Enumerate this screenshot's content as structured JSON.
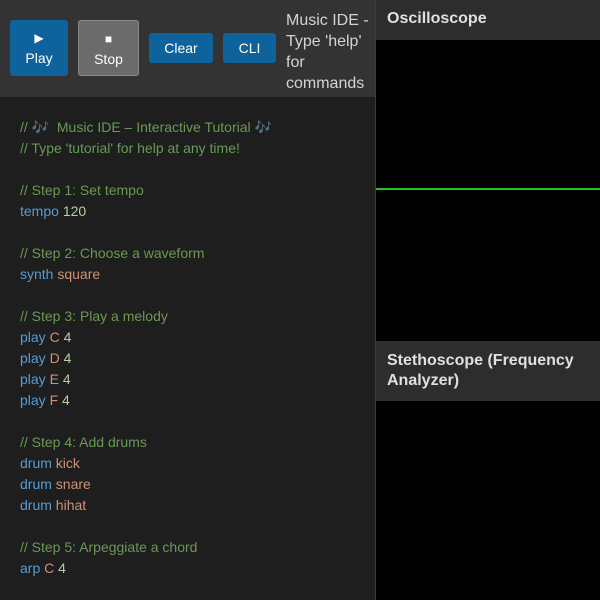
{
  "toolbar": {
    "play": {
      "label": "Play",
      "icon": "▶"
    },
    "stop": {
      "label": "Stop",
      "icon": "■"
    },
    "clear_label": "Clear",
    "cli_label": "CLI",
    "hint": "Music IDE - Type 'help' for commands"
  },
  "editor": {
    "lines": [
      [
        {
          "t": "// 🎶  Music IDE – Interactive Tutorial 🎶",
          "c": "c"
        }
      ],
      [
        {
          "t": "// Type 'tutorial' for help at any time!",
          "c": "c"
        }
      ],
      [],
      [
        {
          "t": "// Step 1: Set tempo",
          "c": "c"
        }
      ],
      [
        {
          "t": "tempo",
          "c": "k"
        },
        {
          "t": " "
        },
        {
          "t": "120",
          "c": "n"
        }
      ],
      [],
      [
        {
          "t": "// Step 2: Choose a waveform",
          "c": "c"
        }
      ],
      [
        {
          "t": "synth",
          "c": "k"
        },
        {
          "t": " "
        },
        {
          "t": "square",
          "c": "s"
        }
      ],
      [],
      [
        {
          "t": "// Step 3: Play a melody",
          "c": "c"
        }
      ],
      [
        {
          "t": "play",
          "c": "k"
        },
        {
          "t": " "
        },
        {
          "t": "C",
          "c": "s"
        },
        {
          "t": " "
        },
        {
          "t": "4",
          "c": "n"
        }
      ],
      [
        {
          "t": "play",
          "c": "k"
        },
        {
          "t": " "
        },
        {
          "t": "D",
          "c": "s"
        },
        {
          "t": " "
        },
        {
          "t": "4",
          "c": "n"
        }
      ],
      [
        {
          "t": "play",
          "c": "k"
        },
        {
          "t": " "
        },
        {
          "t": "E",
          "c": "s"
        },
        {
          "t": " "
        },
        {
          "t": "4",
          "c": "n"
        }
      ],
      [
        {
          "t": "play",
          "c": "k"
        },
        {
          "t": " "
        },
        {
          "t": "F",
          "c": "s"
        },
        {
          "t": " "
        },
        {
          "t": "4",
          "c": "n"
        }
      ],
      [],
      [
        {
          "t": "// Step 4: Add drums",
          "c": "c"
        }
      ],
      [
        {
          "t": "drum",
          "c": "k"
        },
        {
          "t": " "
        },
        {
          "t": "kick",
          "c": "s"
        }
      ],
      [
        {
          "t": "drum",
          "c": "k"
        },
        {
          "t": " "
        },
        {
          "t": "snare",
          "c": "s"
        }
      ],
      [
        {
          "t": "drum",
          "c": "k"
        },
        {
          "t": " "
        },
        {
          "t": "hihat",
          "c": "s"
        }
      ],
      [],
      [
        {
          "t": "// Step 5: Arpeggiate a chord",
          "c": "c"
        }
      ],
      [
        {
          "t": "arp",
          "c": "k"
        },
        {
          "t": " "
        },
        {
          "t": "C",
          "c": "s"
        },
        {
          "t": " "
        },
        {
          "t": "4",
          "c": "n"
        }
      ]
    ]
  },
  "panels": {
    "oscilloscope_title": "Oscilloscope",
    "stethoscope_title": "Stethoscope (Frequency Analyzer)"
  },
  "colors": {
    "accent": "#0e639c",
    "waveform": "#22c322",
    "comment": "#6a9955",
    "keyword": "#569cd6",
    "string": "#ce9178",
    "number": "#b5cea8"
  }
}
